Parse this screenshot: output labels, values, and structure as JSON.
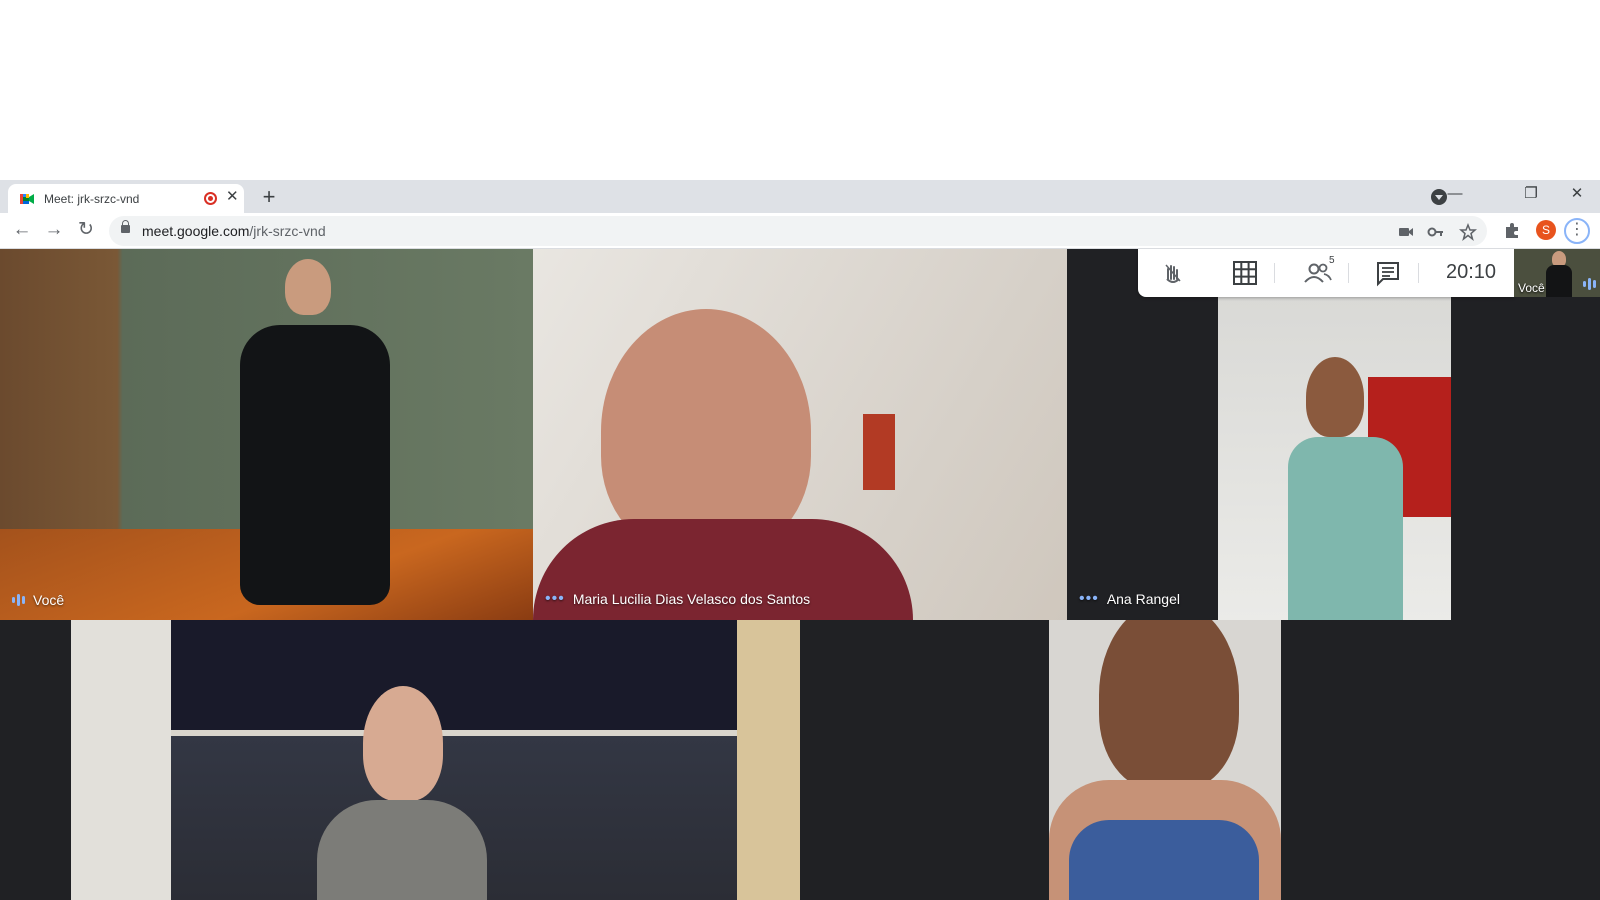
{
  "browser": {
    "tab_title": "Meet: jrk-srzc-vnd",
    "tab_close": "✕",
    "new_tab": "+",
    "url_host": "meet.google.com",
    "url_path": "/jrk-srzc-vnd",
    "window_minimize": "—",
    "window_restore": "❐",
    "window_close": "✕",
    "profile_initial": "S",
    "menu_glyph": "⋮",
    "back_glyph": "←",
    "forward_glyph": "→",
    "reload_glyph": "↻",
    "extensions_icon": "puzzle-icon"
  },
  "meet": {
    "time": "20:10",
    "participant_count": "5",
    "self_label": "Você",
    "participants": [
      {
        "name": "Você",
        "speaking": true
      },
      {
        "name": "Maria Lucilia Dias Velasco dos Santos",
        "speaking": false
      },
      {
        "name": "Ana Rangel",
        "speaking": false
      },
      {
        "name": "",
        "speaking": false
      },
      {
        "name": "",
        "speaking": false
      }
    ]
  },
  "colors": {
    "accent_blue": "#8ab4f8",
    "record_red": "#d93025",
    "stage_bg": "#202124"
  }
}
